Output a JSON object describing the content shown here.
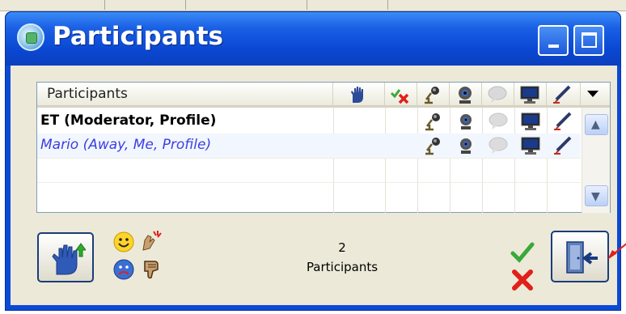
{
  "window": {
    "title": "Participants",
    "icon": "app-globe-icon"
  },
  "list": {
    "header": {
      "name_label": "Participants",
      "columns": [
        "raise-hand-icon",
        "check-x-icon",
        "microphone-icon",
        "webcam-icon",
        "chat-bubble-icon",
        "monitor-icon",
        "pencil-icon"
      ]
    },
    "rows": [
      {
        "name": "ET (Moderator, Profile)",
        "style": "bold",
        "icons": [
          "microphone-icon",
          "webcam-icon",
          "chat-bubble-icon",
          "monitor-icon",
          "pencil-icon"
        ]
      },
      {
        "name": "Mario (Away, Me, Profile)",
        "style": "italic-blue",
        "icons": [
          "microphone-icon",
          "webcam-icon",
          "chat-bubble-icon",
          "monitor-icon",
          "pencil-icon"
        ]
      }
    ]
  },
  "footer": {
    "raise_hand_button": "raise-hand-up-arrow-icon",
    "emoticons": [
      "smile-icon",
      "applause-icon",
      "sad-icon",
      "thumbs-down-icon"
    ],
    "count_value": "2",
    "count_label": "Participants",
    "accept_icon": "check-icon",
    "reject_icon": "x-icon",
    "exit_button": "exit-door-icon"
  },
  "colors": {
    "titlebar": "#0a48d3",
    "client_bg": "#ece9d8",
    "away_text": "#3a3fe0",
    "accent_red": "#e0201a",
    "accept_green": "#3aa83a"
  }
}
